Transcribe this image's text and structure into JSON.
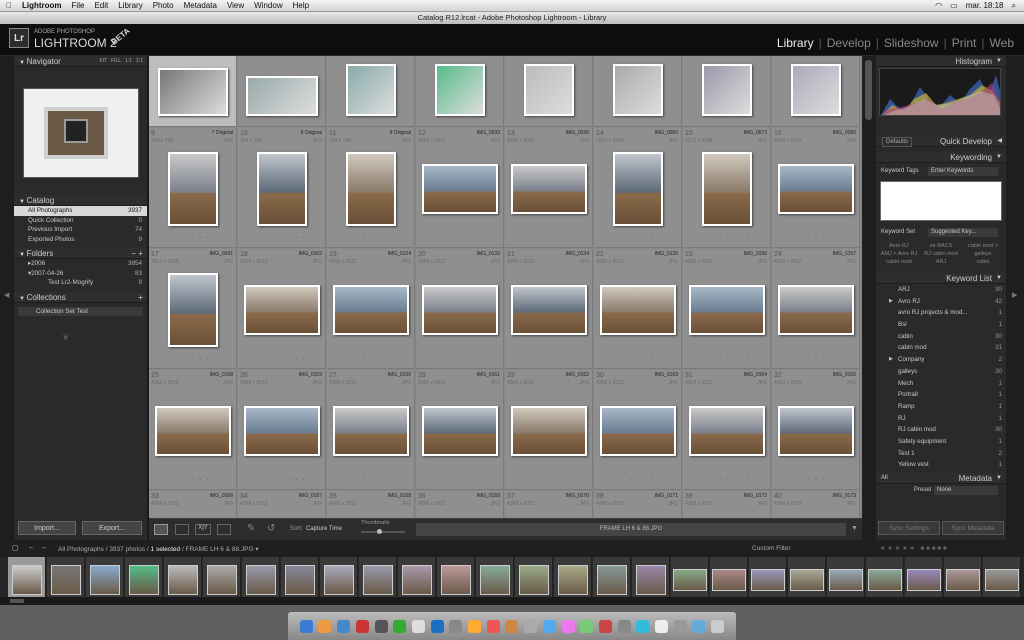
{
  "menubar": {
    "app": "Lightroom",
    "items": [
      "File",
      "Edit",
      "Library",
      "Photo",
      "Metadata",
      "View",
      "Window",
      "Help"
    ],
    "clock": "mar. 18:18"
  },
  "window_title": "Catalog R12.lrcat - Adobe Photoshop Lightroom - Library",
  "brand": {
    "line1": "ADOBE PHOTOSHOP",
    "line2": "LIGHTROOM 2",
    "beta": "BETA",
    "logo": "Lr"
  },
  "modules": [
    "Library",
    "Develop",
    "Slideshow",
    "Print",
    "Web"
  ],
  "navigator": {
    "title": "Navigator",
    "zoom": [
      "FIT",
      "FILL",
      "1:1",
      "2:1"
    ]
  },
  "catalog": {
    "title": "Catalog",
    "items": [
      {
        "label": "All Photographs",
        "count": "3937"
      },
      {
        "label": "Quick Collection",
        "count": "0"
      },
      {
        "label": "Previous Import",
        "count": "74"
      },
      {
        "label": "Exported Photos",
        "count": "9"
      }
    ]
  },
  "folders": {
    "title": "Folders",
    "items": [
      {
        "label": "2006",
        "count": "3854"
      },
      {
        "label": "2007-04-26",
        "count": "83"
      },
      {
        "label": "Test Lr2-Mogrify",
        "count": "9"
      }
    ]
  },
  "collections": {
    "title": "Collections",
    "items": [
      {
        "label": "Collection Set Test"
      }
    ]
  },
  "buttons": {
    "import": "Import...",
    "export": "Export...",
    "sync_settings": "Sync Settings",
    "sync_metadata": "Sync Metadata"
  },
  "histogram": {
    "title": "Histogram"
  },
  "quick_develop": {
    "title": "Quick Develop",
    "preset": "Defaults"
  },
  "keywording": {
    "title": "Keywording",
    "tags_label": "Keyword Tags",
    "tags_value": "Enter Keywords",
    "set_label": "Keyword Set",
    "set_value": "Suggested Key...",
    "suggestions": [
      "Avro RJ",
      "ex-BACX",
      "cabin mod >",
      "AMJ > Avro RJ",
      "RJ cabin mod",
      "galleys",
      "cabin mod",
      "ARJ",
      "cabin"
    ]
  },
  "keyword_list": {
    "title": "Keyword List",
    "items": [
      {
        "label": "ARJ",
        "count": "30"
      },
      {
        "label": "Avro RJ",
        "count": "42"
      },
      {
        "label": "avro RJ projects & mod...",
        "count": "1"
      },
      {
        "label": "Bsl",
        "count": "1"
      },
      {
        "label": "cabin",
        "count": "30"
      },
      {
        "label": "cabin mod",
        "count": "31"
      },
      {
        "label": "Company",
        "count": "2"
      },
      {
        "label": "galleys",
        "count": "30"
      },
      {
        "label": "Mech",
        "count": "1"
      },
      {
        "label": "Portrait",
        "count": "1"
      },
      {
        "label": "Ramp",
        "count": "1"
      },
      {
        "label": "RJ",
        "count": "1"
      },
      {
        "label": "RJ cabin mod",
        "count": "30"
      },
      {
        "label": "Safety equipment",
        "count": "1"
      },
      {
        "label": "Test 1",
        "count": "2"
      },
      {
        "label": "Yellow vest",
        "count": "1"
      }
    ]
  },
  "metadata": {
    "title": "Metadata",
    "filter": "All",
    "preset_label": "Preset",
    "preset_value": "None"
  },
  "grid": {
    "rows": [
      [
        {
          "n": "9",
          "name": "7 Original",
          "dim": "324 x 768",
          "t": "JPG"
        },
        {
          "n": "10",
          "name": "8 Original",
          "dim": "324 x 768",
          "t": "JPG"
        },
        {
          "n": "11",
          "name": "9 Original",
          "dim": "324 x 768",
          "t": "JPG"
        },
        {
          "n": "12",
          "name": "IMG_0033",
          "dim": "4368 x 2912",
          "t": "JPG"
        },
        {
          "n": "13",
          "name": "IMG_0036",
          "dim": "4368 x 2912",
          "t": "JPG"
        },
        {
          "n": "14",
          "name": "IMG_0060",
          "dim": "2912 x 4368",
          "t": "JPG"
        },
        {
          "n": "15",
          "name": "IMG_0073",
          "dim": "2912 x 4368",
          "t": "JPG"
        },
        {
          "n": "16",
          "name": "IMG_0080",
          "dim": "4368 x 2912",
          "t": "JPG"
        }
      ],
      [
        {
          "n": "17",
          "name": "IMG_0091",
          "dim": "2912 x 4368",
          "t": "JPG"
        },
        {
          "n": "18",
          "name": "IMG_0102",
          "dim": "4368 x 2912",
          "t": "JPG"
        },
        {
          "n": "19",
          "name": "IMG_0124",
          "dim": "4368 x 2912",
          "t": "JPG"
        },
        {
          "n": "20",
          "name": "IMG_0133",
          "dim": "4368 x 2912",
          "t": "JPG"
        },
        {
          "n": "21",
          "name": "IMG_0134",
          "dim": "4368 x 2912",
          "t": "JPG"
        },
        {
          "n": "22",
          "name": "IMG_0135",
          "dim": "4368 x 2912",
          "t": "JPG"
        },
        {
          "n": "23",
          "name": "IMG_0156",
          "dim": "4368 x 2912",
          "t": "JPG"
        },
        {
          "n": "24",
          "name": "IMG_0157",
          "dim": "4368 x 2912",
          "t": "JPG"
        }
      ],
      [
        {
          "n": "25",
          "name": "IMG_0158",
          "dim": "4368 x 2912",
          "t": "JPG"
        },
        {
          "n": "26",
          "name": "IMG_0159",
          "dim": "4368 x 2912",
          "t": "JPG"
        },
        {
          "n": "27",
          "name": "IMG_0160",
          "dim": "4368 x 2912",
          "t": "JPG"
        },
        {
          "n": "28",
          "name": "IMG_0161",
          "dim": "4368 x 2912",
          "t": "JPG"
        },
        {
          "n": "29",
          "name": "IMG_0162",
          "dim": "4368 x 2912",
          "t": "JPG"
        },
        {
          "n": "30",
          "name": "IMG_0163",
          "dim": "4368 x 2912",
          "t": "JPG"
        },
        {
          "n": "31",
          "name": "IMG_0164",
          "dim": "4368 x 2912",
          "t": "JPG"
        },
        {
          "n": "32",
          "name": "IMG_0165",
          "dim": "4368 x 2912",
          "t": "JPG"
        }
      ],
      [
        {
          "n": "33",
          "name": "IMG_0166",
          "dim": "4368 x 2912",
          "t": "JPG"
        },
        {
          "n": "34",
          "name": "IMG_0167",
          "dim": "4368 x 2912",
          "t": "JPG"
        },
        {
          "n": "35",
          "name": "IMG_0168",
          "dim": "4368 x 2912",
          "t": "JPG"
        },
        {
          "n": "36",
          "name": "IMG_0169",
          "dim": "4368 x 2912",
          "t": "JPG"
        },
        {
          "n": "37",
          "name": "IMG_0170",
          "dim": "4368 x 2912",
          "t": "JPG"
        },
        {
          "n": "38",
          "name": "IMG_0171",
          "dim": "4368 x 2912",
          "t": "JPG"
        },
        {
          "n": "39",
          "name": "IMG_0172",
          "dim": "4368 x 2912",
          "t": "JPG"
        },
        {
          "n": "40",
          "name": "IMG_0173",
          "dim": "4368 x 2912",
          "t": "JPG"
        }
      ]
    ]
  },
  "toolbar": {
    "sort_label": "Sort:",
    "sort_value": "Capture Time",
    "thumbs_label": "Thumbnails",
    "filename": "FRAME LH 6 & 88.JPG"
  },
  "filmstrip": {
    "source": "All Photographs",
    "info": "/ 3937 photos /",
    "selected": "1 selected",
    "file": "/ FRAME LH 6 & 88.JPG",
    "filter": "Custom Filter"
  },
  "colors": {
    "bg": "#1a1a1a",
    "panel": "#2a2a2a",
    "grid": "#888888",
    "accent": "#eeeeee"
  }
}
